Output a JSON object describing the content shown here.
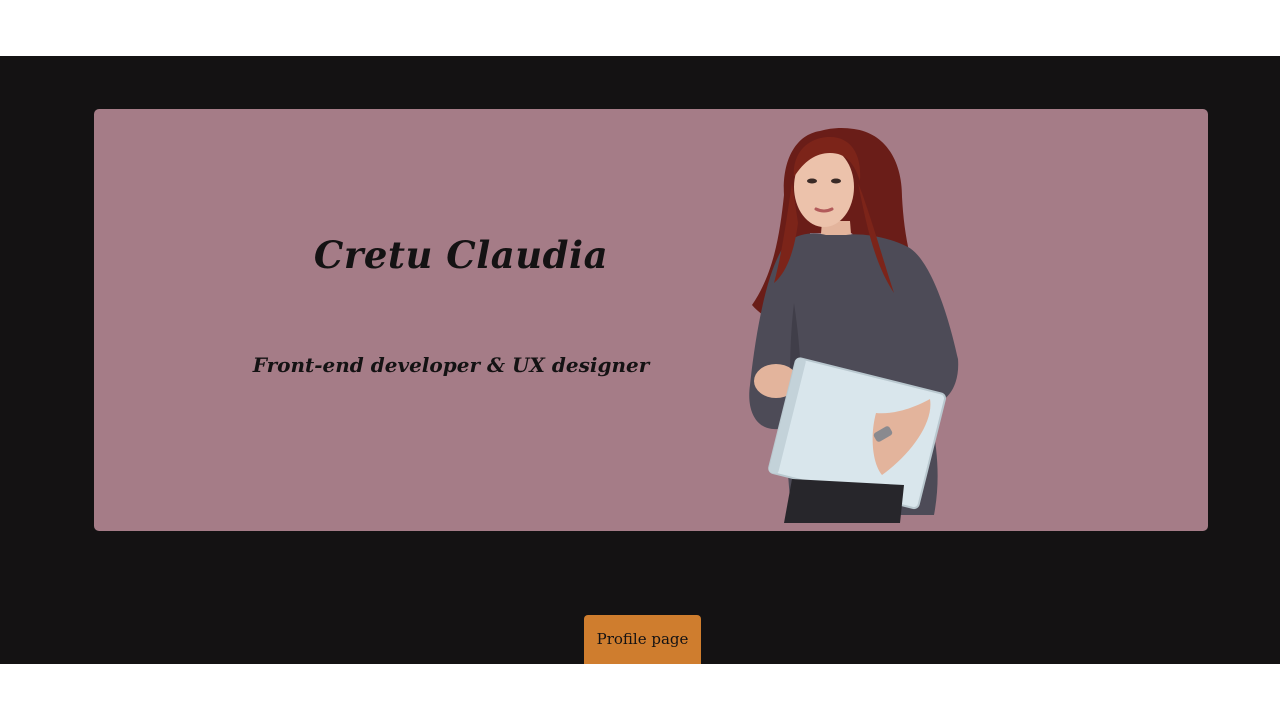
{
  "hero": {
    "name": "Cretu Claudia",
    "subtitle": "Front-end developer & UX designer"
  },
  "portrait": {
    "icon": "person-holding-laptop-photo"
  },
  "actions": {
    "profile_button": "Profile page"
  },
  "colors": {
    "page_background": "#141213",
    "hero_background": "#a57c87",
    "button_background": "#cf7d2e",
    "text": "#141213"
  }
}
